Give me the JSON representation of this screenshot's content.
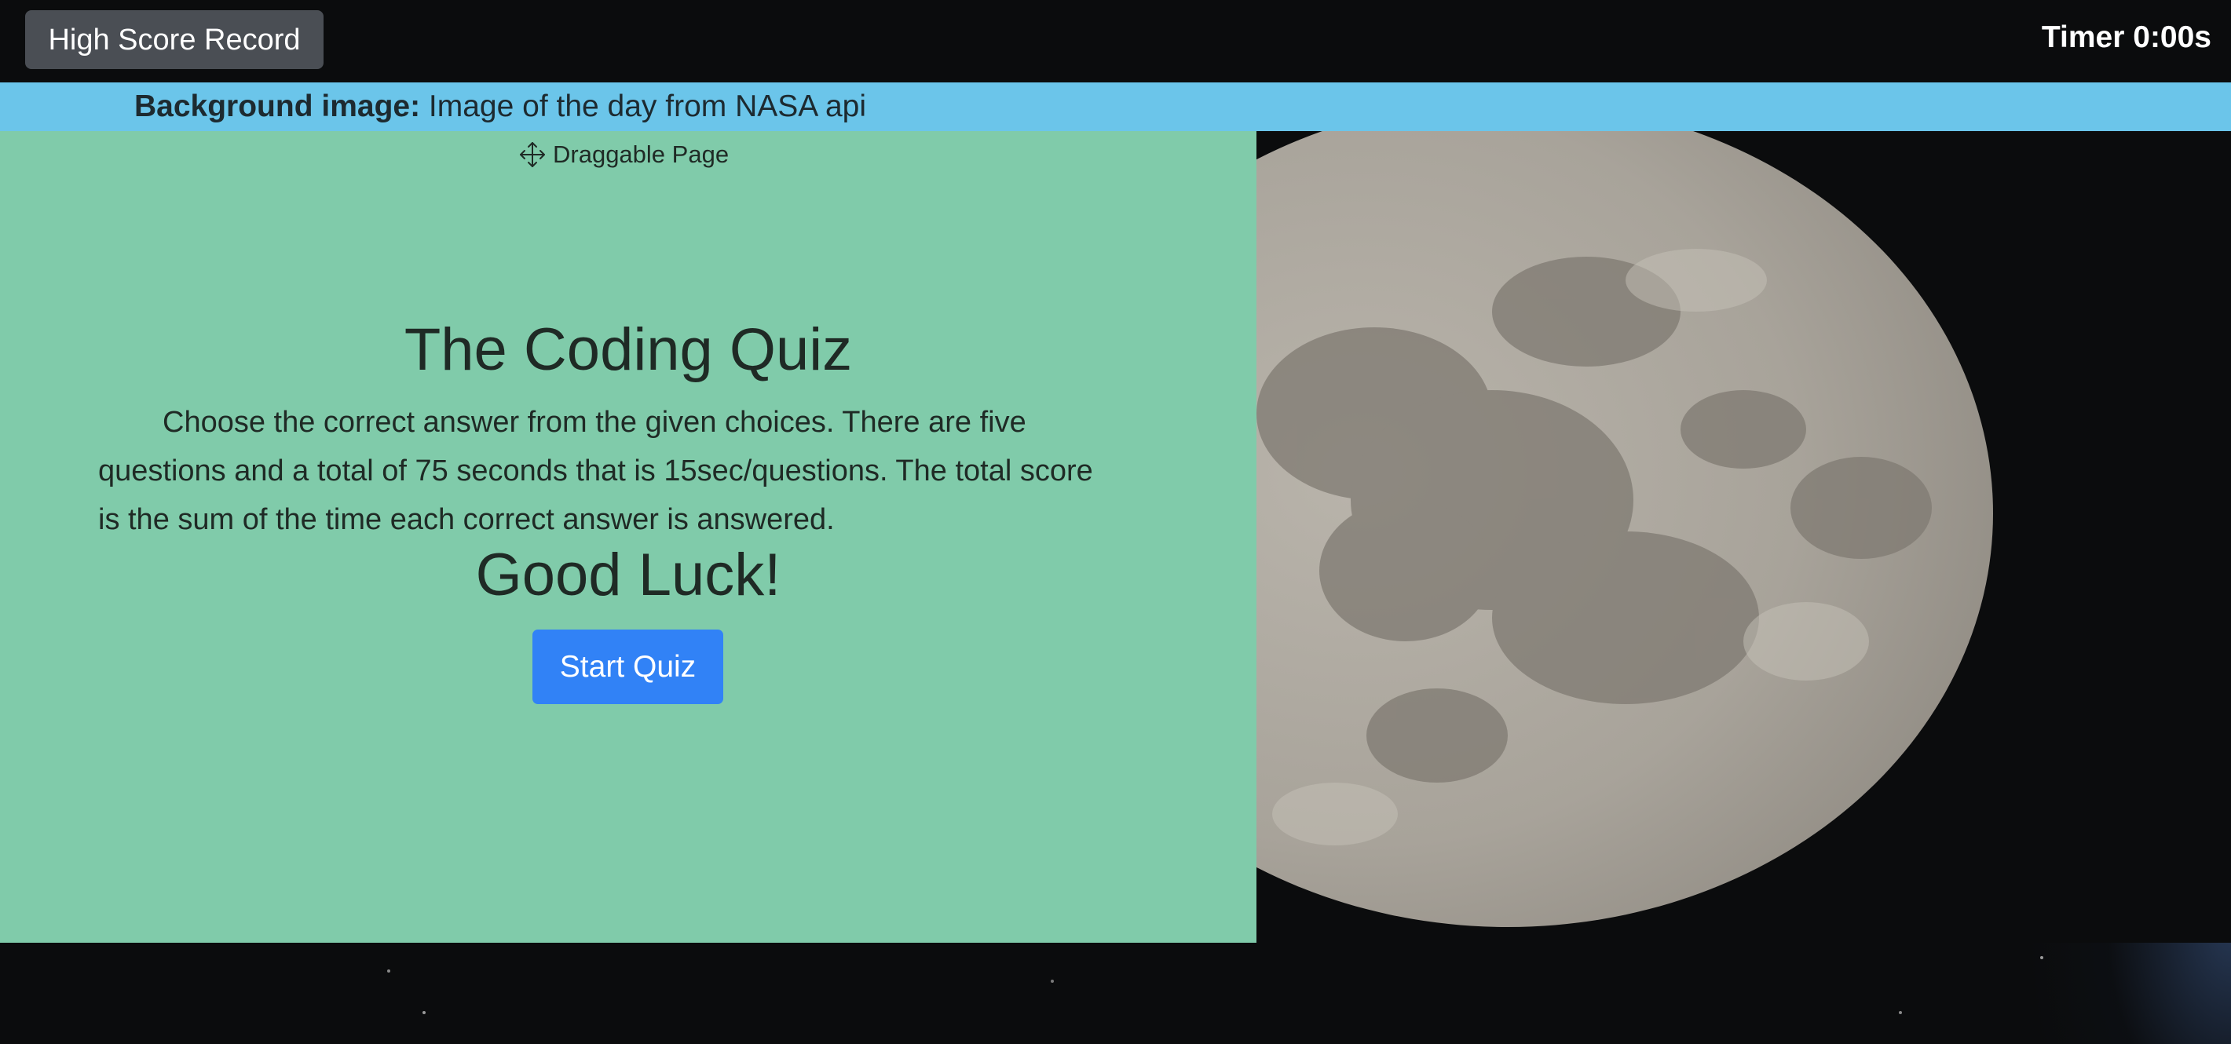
{
  "header": {
    "high_score_label": "High Score Record",
    "timer_label": "Timer",
    "timer_value": "0:00s"
  },
  "banner": {
    "label": "Background image:",
    "text": " Image of the day from NASA api"
  },
  "quiz_panel": {
    "drag_label": "Draggable Page",
    "title": "The Coding Quiz",
    "instructions": "Choose the correct answer from the given choices. There are five questions and a total of 75 seconds that is 15sec/questions. The total score is the sum of the time each correct answer is answered.",
    "good_luck": "Good Luck!",
    "start_label": "Start Quiz"
  },
  "colors": {
    "banner": "#6bc5ea",
    "panel": "#80cbaa",
    "primary_button": "#3182f6",
    "secondary_button": "#4a4e54"
  },
  "icons": {
    "drag": "move-arrows-icon"
  }
}
